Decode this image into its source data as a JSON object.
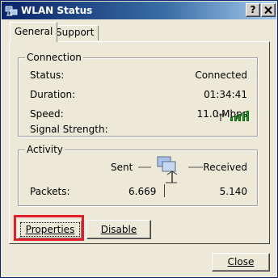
{
  "window": {
    "title": "WLAN Status",
    "help_label": "?",
    "close_label": "X"
  },
  "tabs": [
    {
      "label": "General",
      "active": true
    },
    {
      "label": "Support",
      "active": false
    }
  ],
  "connection": {
    "title": "Connection",
    "rows": [
      {
        "label": "Status:",
        "value": "Connected"
      },
      {
        "label": "Duration:",
        "value": "01:34:41"
      },
      {
        "label": "Speed:",
        "value": "11.0 Mbps"
      },
      {
        "label": "Signal Strength:",
        "value": ""
      }
    ],
    "signal_bars": 5,
    "signal_color": "#1fa01f"
  },
  "activity": {
    "title": "Activity",
    "sent_label": "Sent",
    "received_label": "Received",
    "packets_label": "Packets:",
    "packets_sent": "6.669",
    "packets_received": "5.140",
    "icon": "network-computers-icon"
  },
  "buttons": {
    "properties": "Properties",
    "disable": "Disable",
    "close": "Close"
  },
  "colors": {
    "highlight": "#e01f2a",
    "title_bar": "#0a246a"
  }
}
